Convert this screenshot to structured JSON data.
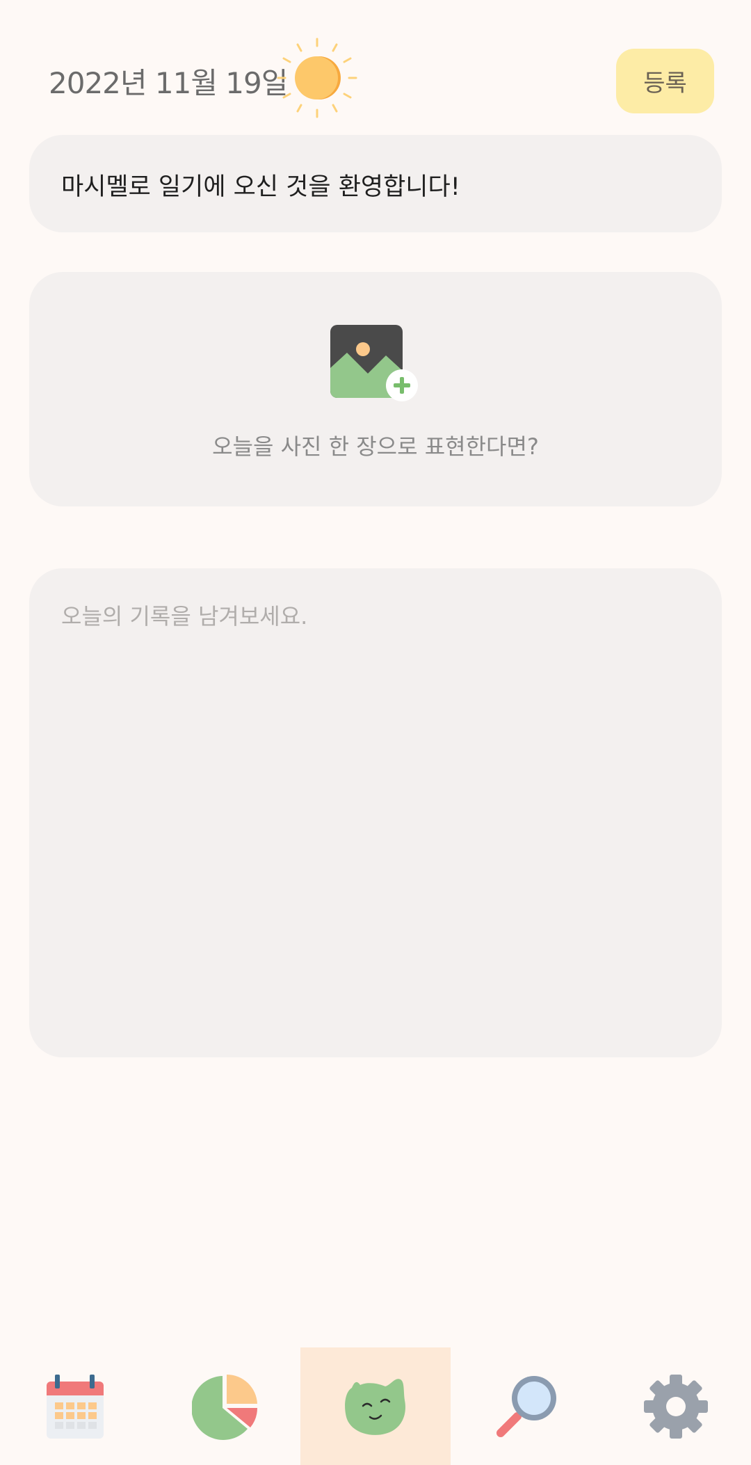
{
  "header": {
    "date": "2022년 11월 19일",
    "weather_icon": "sun-icon",
    "register_label": "등록"
  },
  "welcome": {
    "text": "마시멜로 일기에 오신 것을 환영합니다!"
  },
  "photo": {
    "icon": "add-photo-icon",
    "prompt": "오늘을 사진 한 장으로 표현한다면?"
  },
  "diary": {
    "placeholder": "오늘의 기록을 남겨보세요.",
    "value": ""
  },
  "nav": {
    "items": [
      {
        "icon": "calendar-icon",
        "active": false
      },
      {
        "icon": "pie-chart-icon",
        "active": false
      },
      {
        "icon": "marshmallow-face-icon",
        "active": true
      },
      {
        "icon": "magnifier-icon",
        "active": false
      },
      {
        "icon": "gear-icon",
        "active": false
      }
    ],
    "active_color": "#fde9d7"
  },
  "colors": {
    "background": "#fef9f6",
    "card": "#f3f0ef",
    "register_button": "#fdeca6",
    "sun": "#fdc86a"
  }
}
